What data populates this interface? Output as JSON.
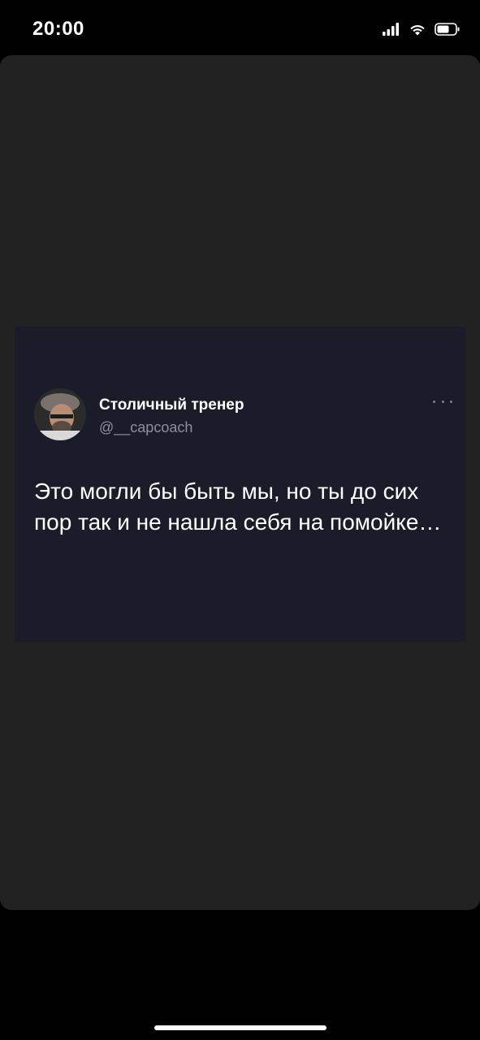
{
  "status_bar": {
    "time": "20:00",
    "icons": [
      "cellular-signal-icon",
      "wifi-icon",
      "battery-icon"
    ]
  },
  "story": {
    "background_color": "#222222",
    "tweet": {
      "background_color": "#1a1c2a",
      "author_name": "Столичный тренер",
      "author_handle": "@__capcoach",
      "text": "Это могли бы быть мы, но ты до сих пор так и не нашла себя на помойке…",
      "more_icon": "more-options-icon",
      "avatar_icon": "avatar-photo"
    }
  },
  "colors": {
    "accent_text": "#ffffff",
    "handle_text": "#8b8f9e"
  }
}
